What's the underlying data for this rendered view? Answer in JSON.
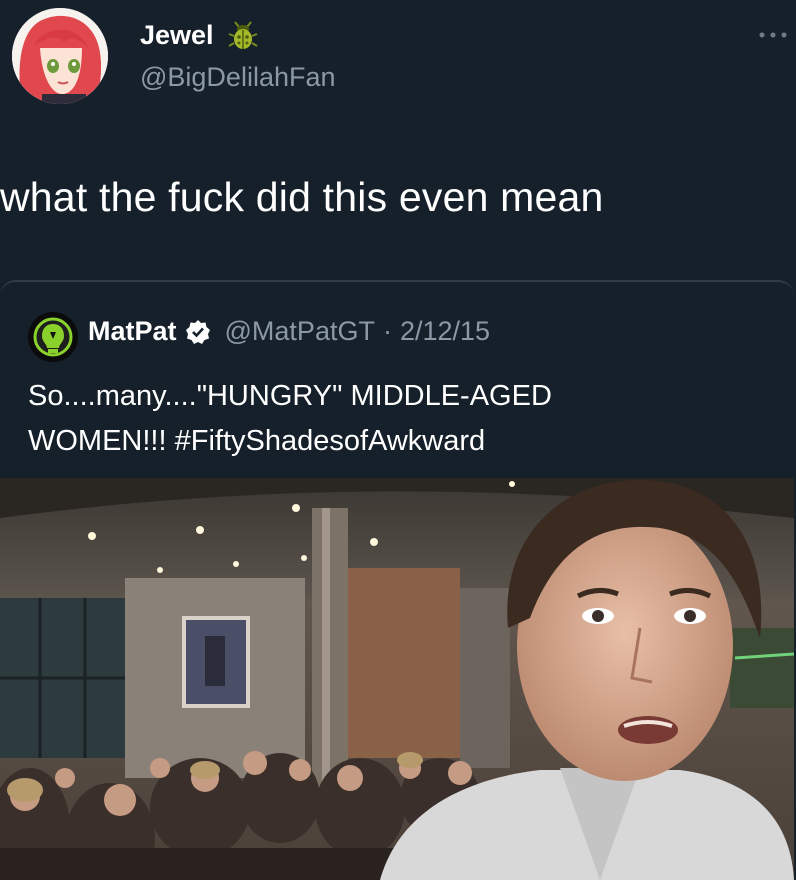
{
  "tweet": {
    "display_name": "Jewel",
    "handle": "@BigDelilahFan",
    "text": "what the fuck did this even mean",
    "badge_icon": "beetle-emoji-icon",
    "more_icon": "more-options-icon"
  },
  "quoted_tweet": {
    "display_name": "MatPat",
    "verified": true,
    "handle": "@MatPatGT",
    "separator": "·",
    "date": "2/12/15",
    "text_line1": "So....many....\"HUNGRY\" MIDDLE-AGED",
    "text_line2": "WOMEN!!! #FiftyShadesofAwkward"
  },
  "colors": {
    "background": "#15202b",
    "secondary_text": "#8b98a5",
    "verified_badge": "#ffffff",
    "border": "#2f3b47"
  }
}
